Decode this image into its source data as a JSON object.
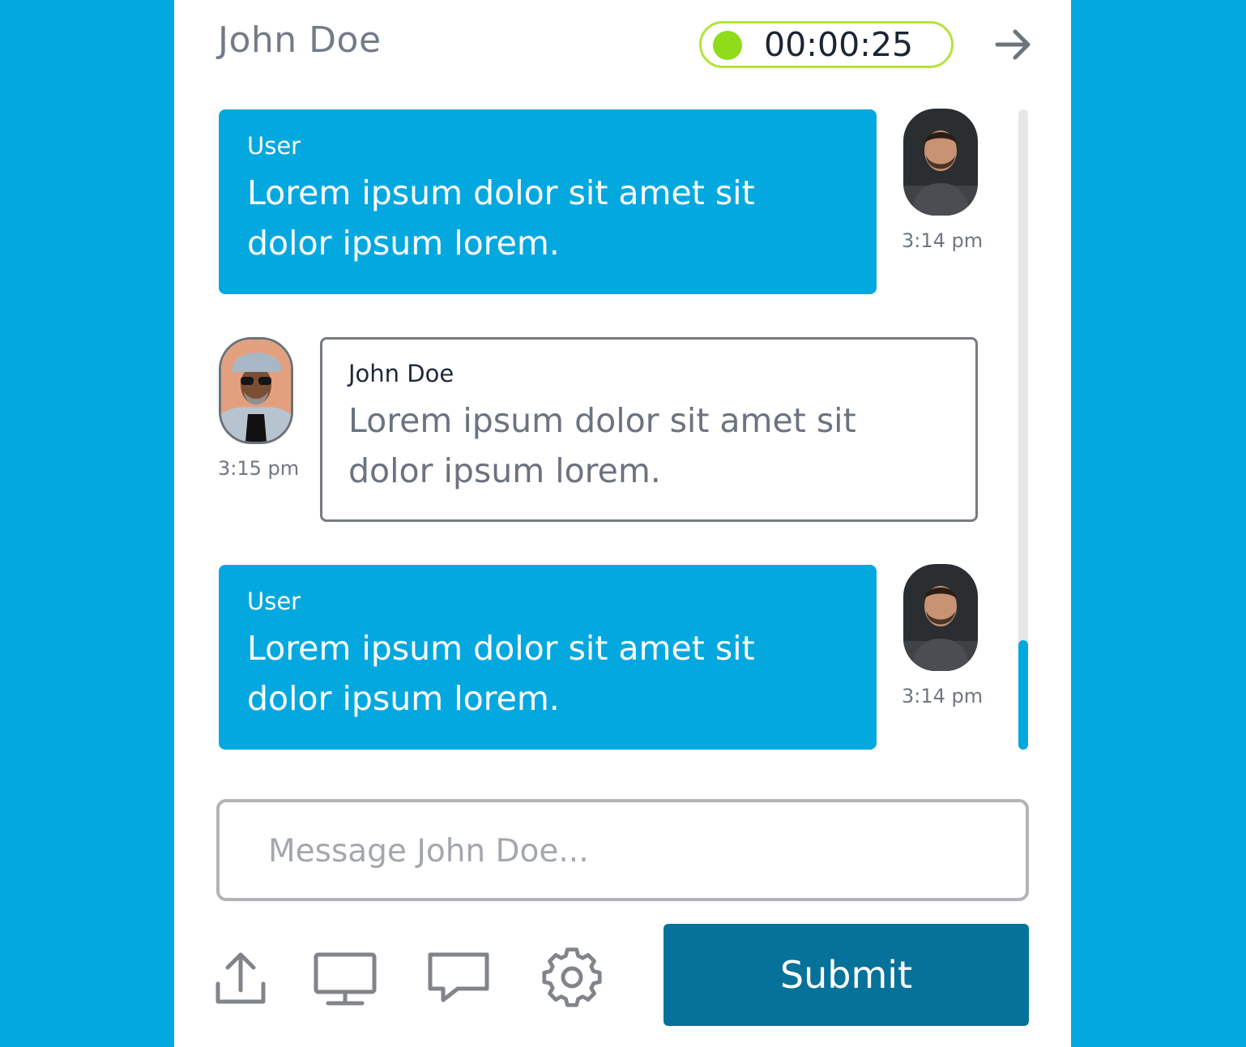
{
  "header": {
    "contact_name": "John Doe",
    "timer": "00:00:25",
    "timer_status_color": "#8fdc1a",
    "exit_icon": "arrow-right-icon"
  },
  "messages": [
    {
      "sender": "User",
      "text": "Lorem ipsum dolor sit amet sit dolor ipsum lorem.",
      "time": "3:14 pm",
      "side": "right",
      "style": "filled"
    },
    {
      "sender": "John Doe",
      "text": "Lorem ipsum dolor sit amet sit dolor ipsum lorem.",
      "time": "3:15 pm",
      "side": "left",
      "style": "outlined"
    },
    {
      "sender": "User",
      "text": "Lorem ipsum dolor sit amet sit dolor ipsum lorem.",
      "time": "3:14 pm",
      "side": "right",
      "style": "filled"
    }
  ],
  "scroll": {
    "position_fraction": 0.83
  },
  "composer": {
    "placeholder": "Message John Doe...",
    "value": ""
  },
  "toolbar": {
    "icons": [
      "upload-icon",
      "screen-share-icon",
      "chat-icon",
      "settings-icon"
    ],
    "submit_label": "Submit"
  },
  "colors": {
    "background": "#03a8df",
    "user_bubble": "#03a8df",
    "submit_button": "#067299",
    "timer_border": "#b5e33a"
  }
}
